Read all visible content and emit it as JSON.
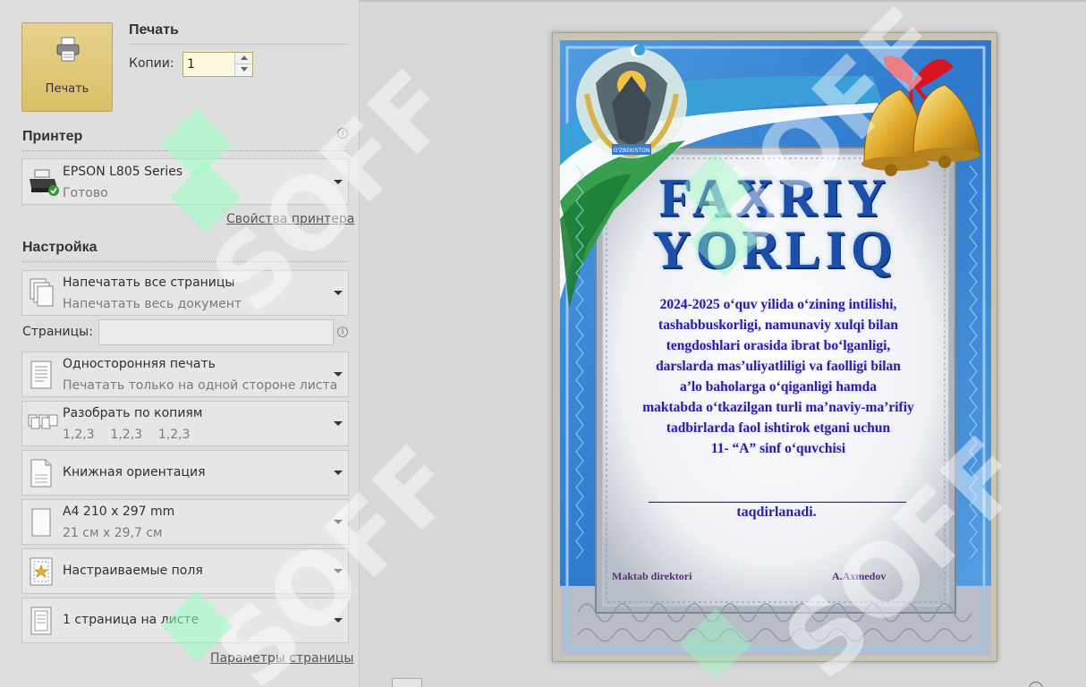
{
  "print_section": {
    "title": "Печать",
    "print_button_label": "Печать",
    "copies_label": "Копии:",
    "copies_value": "1"
  },
  "printer_section": {
    "title": "Принтер",
    "printer_name": "EPSON L805 Series",
    "printer_status": "Готово",
    "properties_link": "Свойства принтера"
  },
  "settings_section": {
    "title": "Настройка",
    "pages_label": "Страницы:",
    "pages_value": "",
    "page_setup_link": "Параметры страницы",
    "items": [
      {
        "title": "Напечатать все страницы",
        "subtitle": "Напечатать весь документ",
        "icon": "pages-icon"
      },
      {
        "title": "Односторонняя печать",
        "subtitle": "Печатать только на одной стороне листа",
        "icon": "one-sided-icon"
      },
      {
        "title": "Разобрать по копиям",
        "subtitle": "1,2,3    1,2,3    1,2,3",
        "icon": "collate-icon"
      },
      {
        "title": "Книжная ориентация",
        "subtitle": "",
        "icon": "portrait-orientation-icon"
      },
      {
        "title": "A4 210 x 297 mm",
        "subtitle": "21 см x 29,7 см",
        "icon": "paper-size-icon"
      },
      {
        "title": "Настраиваемые поля",
        "subtitle": "",
        "icon": "margins-icon"
      },
      {
        "title": "1 страница на листе",
        "subtitle": "",
        "icon": "pages-per-sheet-icon"
      }
    ]
  },
  "preview": {
    "title_line1": "FAXRIY",
    "title_line2": "YORLIQ",
    "body_lines": [
      "2024-2025 o‘quv yilida o‘zining intilishi,",
      "tashabbuskorligi, namunaviy xulqi bilan",
      "tengdoshlari orasida ibrat bo‘lganligi,",
      "darslarda mas’uliyatliligi va faolligi bilan",
      "a’lo baholarga o‘qiganligi hamda",
      "maktabda o‘tkazilgan turli ma’naviy-ma’rifiy",
      "tadbirlarda faol ishtirok etgani uchun",
      "11- “A” sinf o‘quvchisi"
    ],
    "blank_line": "____________________________________",
    "awarded": "taqdirlanadi.",
    "signature_left": "Maktab direktori",
    "signature_right": "A.Axmedov",
    "emblem_label": "O'ZBEKISTON"
  },
  "watermark_text": "SOFF",
  "colors": {
    "print_button": "#d9bf66",
    "title_blue": "#1b4fa8",
    "body_text": "#2d1da0",
    "frame_blue": "#2a6cbf"
  }
}
